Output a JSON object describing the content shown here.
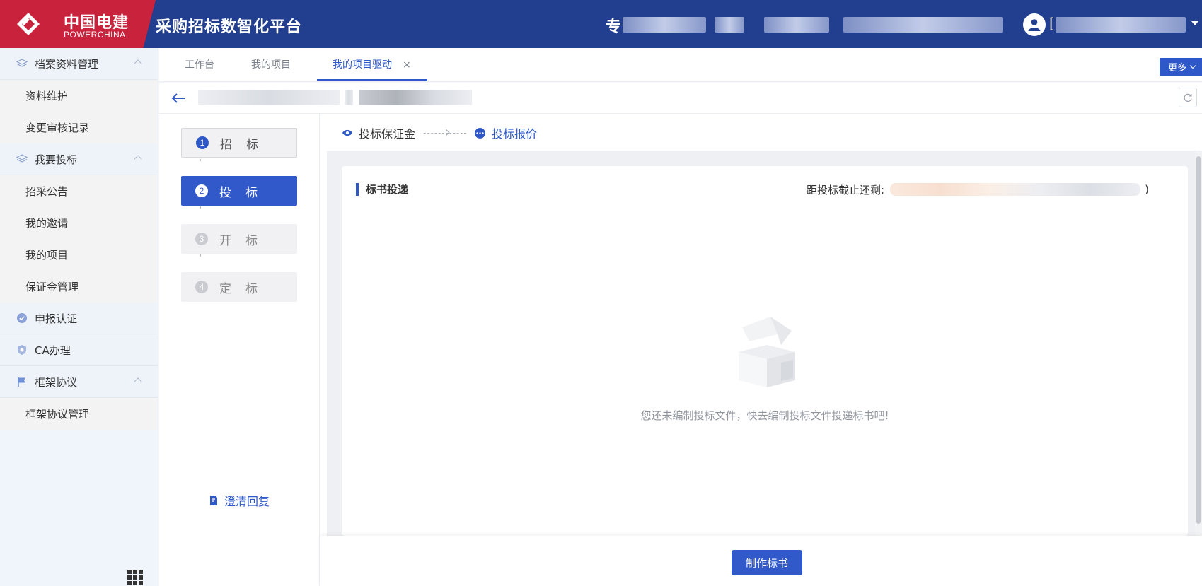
{
  "header": {
    "logo_cn": "中国电建",
    "logo_en": "POWERCHINA",
    "platform_title": "采购招标数智化平台",
    "org_name_prefix": "专",
    "org_name_partial": "["
  },
  "sidebar": {
    "groups": [
      {
        "label": "档案资料管理",
        "items": [
          "资料维护",
          "变更审核记录"
        ]
      },
      {
        "label": "我要投标",
        "items": [
          "招采公告",
          "我的邀请",
          "我的项目",
          "保证金管理"
        ]
      },
      {
        "label": "申报认证",
        "items": []
      },
      {
        "label": "CA办理",
        "items": []
      },
      {
        "label": "框架协议",
        "items": [
          "框架协议管理"
        ]
      }
    ]
  },
  "tabs": {
    "items": [
      "工作台",
      "我的项目",
      "我的项目驱动"
    ],
    "active": "我的项目驱动",
    "close": "×",
    "more_label": "更多"
  },
  "stages": {
    "items": [
      {
        "num": "1",
        "label": "招标",
        "state": "done"
      },
      {
        "num": "2",
        "label": "投标",
        "state": "current"
      },
      {
        "num": "3",
        "label": "开标",
        "state": "todo"
      },
      {
        "num": "4",
        "label": "定标",
        "state": "todo"
      }
    ],
    "clarify_label": "澄清回复"
  },
  "substeps": {
    "step1": "投标保证金",
    "step2": "投标报价"
  },
  "card": {
    "title": "标书投递",
    "deadline_label": "距投标截止还剩:",
    "deadline_suffix": ")",
    "empty_text": "您还未编制投标文件，快去编制投标文件投递标书吧!",
    "primary_button": "制作标书"
  },
  "colors": {
    "header_bg": "#223e8f",
    "logo_red": "#c8223d",
    "accent": "#2e58c8"
  }
}
